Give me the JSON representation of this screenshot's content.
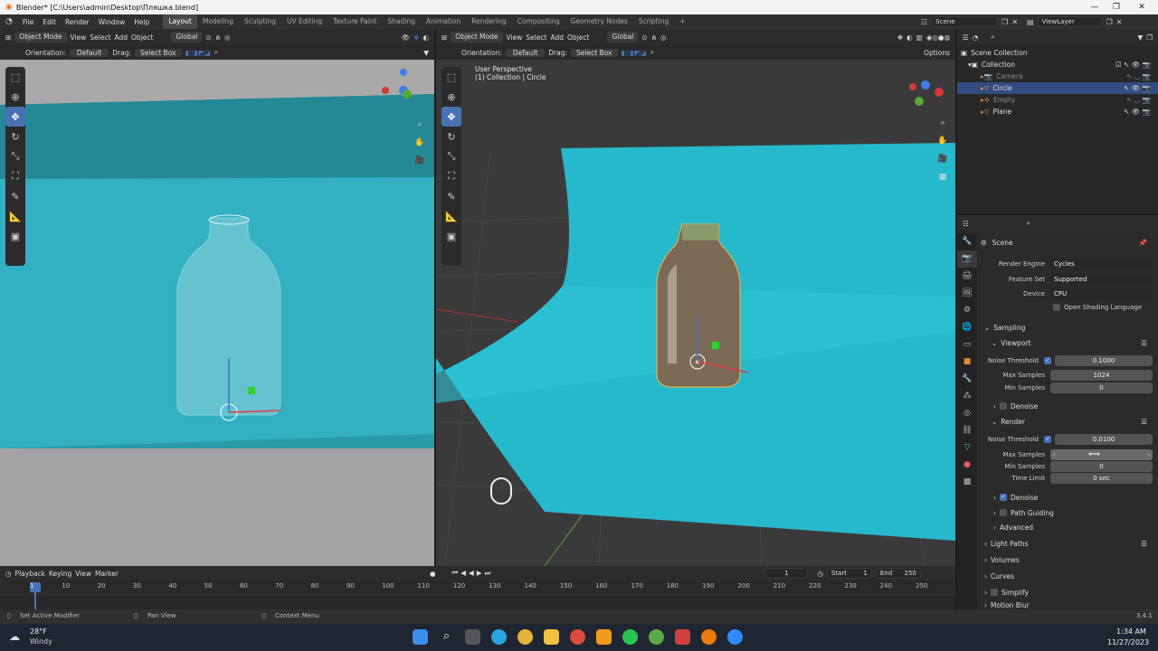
{
  "title_bar": {
    "text": "Blender* [C:\\Users\\admin\\Desktop\\Пляшка.blend]"
  },
  "menu": {
    "items": [
      "File",
      "Edit",
      "Render",
      "Window",
      "Help"
    ]
  },
  "workspaces": [
    "Layout",
    "Modeling",
    "Sculpting",
    "UV Editing",
    "Texture Paint",
    "Shading",
    "Animation",
    "Rendering",
    "Compositing",
    "Geometry Nodes",
    "Scripting"
  ],
  "workspace_add": "+",
  "scene": {
    "label": "Scene",
    "viewlayer": "ViewLayer"
  },
  "left_viewport": {
    "mode": "Object Mode",
    "menus": [
      "View",
      "Select",
      "Add",
      "Object"
    ],
    "transform": "Global",
    "orientation_label": "Orientation:",
    "orientation_value": "Default",
    "drag_label": "Drag:",
    "drag_value": "Select Box"
  },
  "right_viewport": {
    "mode": "Object Mode",
    "menus": [
      "View",
      "Select",
      "Add",
      "Object"
    ],
    "transform": "Global",
    "orientation_label": "Orientation:",
    "orientation_value": "Default",
    "drag_label": "Drag:",
    "drag_value": "Select Box",
    "options": "Options",
    "overlay_line1": "User Perspective",
    "overlay_line2": "(1) Collection | Circle"
  },
  "outliner": {
    "root": "Scene Collection",
    "collection": "Collection",
    "items": [
      {
        "name": "Camera",
        "dim": true
      },
      {
        "name": "Circle",
        "selected": true
      },
      {
        "name": "Empty",
        "dim": true
      },
      {
        "name": "Plane"
      }
    ]
  },
  "properties": {
    "context": "Scene",
    "render_engine_label": "Render Engine",
    "render_engine": "Cycles",
    "feature_set_label": "Feature Set",
    "feature_set": "Supported",
    "device_label": "Device",
    "device": "CPU",
    "osl": "Open Shading Language",
    "sampling": "Sampling",
    "viewport": "Viewport",
    "vp_noise_label": "Noise Threshold",
    "vp_noise": "0.1000",
    "vp_max_label": "Max Samples",
    "vp_max": "1024",
    "vp_min_label": "Min Samples",
    "vp_min": "0",
    "denoise": "Denoise",
    "render": "Render",
    "r_noise_label": "Noise Threshold",
    "r_noise": "0.0100",
    "r_max_label": "Max Samples",
    "r_max": "",
    "r_min_label": "Min Samples",
    "r_min": "0",
    "r_time_label": "Time Limit",
    "r_time": "0 sec",
    "r_denoise": "Denoise",
    "path_guiding": "Path Guiding",
    "advanced": "Advanced",
    "light_paths": "Light Paths",
    "volumes": "Volumes",
    "curves": "Curves",
    "simplify": "Simplify",
    "motion_blur": "Motion Blur"
  },
  "timeline": {
    "menus": [
      "Playback",
      "Keying",
      "View",
      "Marker"
    ],
    "current_frame": "1",
    "start_label": "Start",
    "start": "1",
    "end_label": "End",
    "end": "250",
    "ticks": [
      "1",
      "10",
      "20",
      "30",
      "40",
      "50",
      "60",
      "70",
      "80",
      "90",
      "100",
      "110",
      "120",
      "130",
      "140",
      "150",
      "160",
      "170",
      "180",
      "190",
      "200",
      "210",
      "220",
      "230",
      "240",
      "250"
    ]
  },
  "status": {
    "left": "Set Active Modifier",
    "mid": "Pan View",
    "right": "Context Menu",
    "version": "3.4.1"
  },
  "taskbar": {
    "temp": "28°F",
    "weather": "Windy",
    "time": "1:34 AM",
    "date": "11/27/2023"
  },
  "colors": {
    "accent": "#4772b3",
    "backdrop": "#27b5c9",
    "selection": "#334d80"
  }
}
